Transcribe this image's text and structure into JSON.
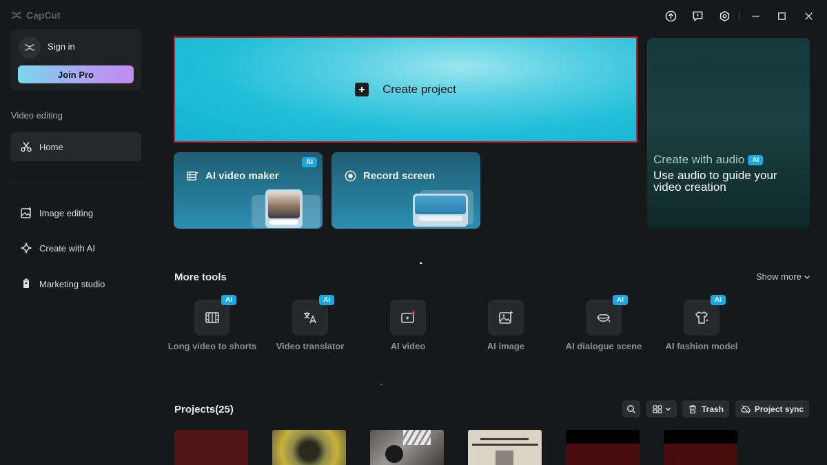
{
  "app": {
    "title": "CapCut"
  },
  "account": {
    "signin_label": "Sign in",
    "join_pro_label": "Join Pro"
  },
  "sidebar": {
    "section_label": "Video editing",
    "items": [
      {
        "label": "Home",
        "icon": "scissors-icon",
        "active": true
      },
      {
        "label": "Image editing",
        "icon": "image-edit-icon",
        "active": false
      },
      {
        "label": "Create with AI",
        "icon": "sparkle-icon",
        "active": false
      },
      {
        "label": "Marketing studio",
        "icon": "shopping-bag-icon",
        "active": false
      }
    ]
  },
  "hero": {
    "create_project_label": "Create project"
  },
  "cards": {
    "ai_video_maker": {
      "label": "AI video maker",
      "badge": "AI"
    },
    "record_screen": {
      "label": "Record screen"
    },
    "audio": {
      "title": "Create with audio",
      "badge": "AI",
      "subtitle": "Use audio to guide your video creation"
    }
  },
  "more_tools": {
    "title": "More tools",
    "show_more_label": "Show more",
    "items": [
      {
        "label": "Long video to shorts",
        "icon": "film-split-icon",
        "badge": "AI"
      },
      {
        "label": "Video translator",
        "icon": "translate-icon",
        "badge": "AI"
      },
      {
        "label": "AI video",
        "icon": "video-play-icon",
        "badge": ""
      },
      {
        "label": "AI image",
        "icon": "image-sparkle-icon",
        "badge": ""
      },
      {
        "label": "AI dialogue scene",
        "icon": "lips-icon",
        "badge": "AI"
      },
      {
        "label": "AI fashion model",
        "icon": "shirt-icon",
        "badge": "AI"
      }
    ]
  },
  "projects": {
    "title": "Projects(25)",
    "trash_label": "Trash",
    "sync_label": "Project sync"
  },
  "colors": {
    "background": "#161819",
    "accent_cyan": "#1ec3dc",
    "ai_badge": "#1ba9e1",
    "highlight_border": "#e0141b"
  }
}
